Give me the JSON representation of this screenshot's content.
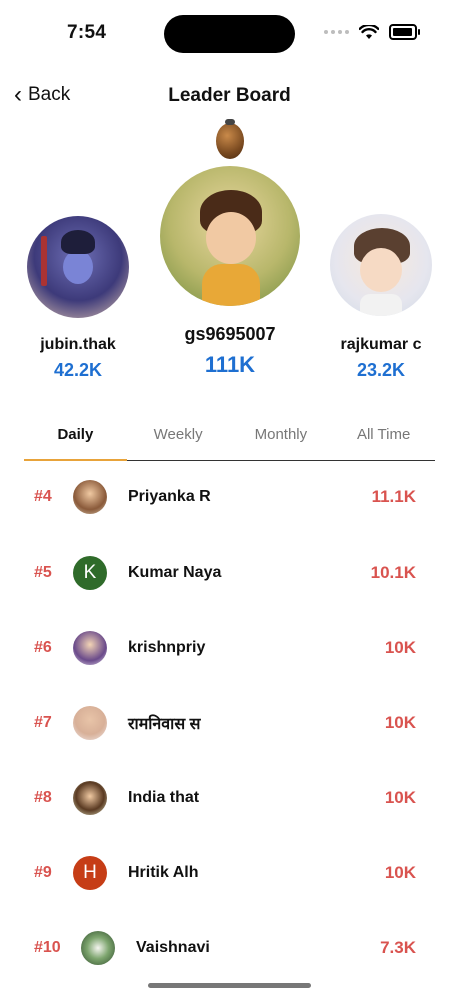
{
  "status_bar": {
    "time": "7:54"
  },
  "header": {
    "back_label": "Back",
    "title": "Leader Board"
  },
  "podium": {
    "first": {
      "name": "gs9695007",
      "score": "111K"
    },
    "second": {
      "name": "jubin.thak",
      "score": "42.2K"
    },
    "third": {
      "name": "rajkumar c",
      "score": "23.2K"
    }
  },
  "tabs": [
    {
      "label": "Daily"
    },
    {
      "label": "Weekly"
    },
    {
      "label": "Monthly"
    },
    {
      "label": "All Time"
    }
  ],
  "active_tab": "Daily",
  "leaders": [
    {
      "rank": "#4",
      "name": "Priyanka R",
      "score": "11.1K",
      "avatar": "photo-girl-icon"
    },
    {
      "rank": "#5",
      "name": "Kumar Naya",
      "score": "10.1K",
      "avatar_letter": "K",
      "avatar_color": "#2f6b2a"
    },
    {
      "rank": "#6",
      "name": "krishnpriy",
      "score": "10K",
      "avatar": "photo-krishna-icon"
    },
    {
      "rank": "#7",
      "name": "रामनिवास स",
      "score": "10K",
      "avatar": "photo-man-icon"
    },
    {
      "rank": "#8",
      "name": "India that",
      "score": "10K",
      "avatar": "photo-boy-icon"
    },
    {
      "rank": "#9",
      "name": "Hritik Alh",
      "score": "10K",
      "avatar_letter": "H",
      "avatar_color": "#c63d16"
    },
    {
      "rank": "#10",
      "name": "Vaishnavi",
      "score": "7.3K",
      "avatar": "photo-lotus-icon"
    }
  ],
  "colors": {
    "accent_tab": "#e8a33a",
    "rank_red": "#d9534f",
    "score_blue": "#1e6fd1"
  }
}
